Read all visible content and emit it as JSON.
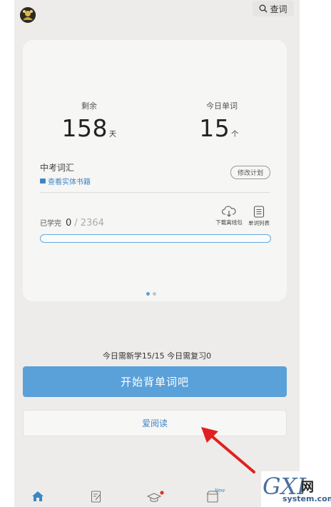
{
  "header": {
    "search_label": "查词"
  },
  "card": {
    "remaining_label": "剩余",
    "remaining_value": "158",
    "remaining_unit": "天",
    "today_words_label": "今日单词",
    "today_words_value": "15",
    "today_words_unit": "个",
    "book_name": "中考词汇",
    "view_book_link": "查看实体书籍",
    "edit_plan_label": "修改计划",
    "learned_label": "已学完",
    "learned_done": "0",
    "learned_total": "/ 2364",
    "learned_progress": 0,
    "download_label": "下载离线包",
    "word_list_label": "单词列表",
    "page_dots": [
      "active",
      "inactive"
    ]
  },
  "today_summary": "今日需新学15/15 今日需复习0",
  "start_button_label": "开始背单词吧",
  "read_button_label": "爱阅读",
  "tabbar": {
    "items": [
      "home-icon",
      "notebook-icon",
      "graduation-cap-icon",
      "shop-icon"
    ],
    "new_badge": "New"
  },
  "watermark": {
    "main": "GXI",
    "net": "网",
    "sub": "system.com"
  },
  "colors": {
    "accent_blue": "#5aa0d9",
    "link_blue": "#3d86c6",
    "background": "#edecea",
    "card_bg": "#f6f6f4",
    "arrow_red": "#e02020"
  }
}
